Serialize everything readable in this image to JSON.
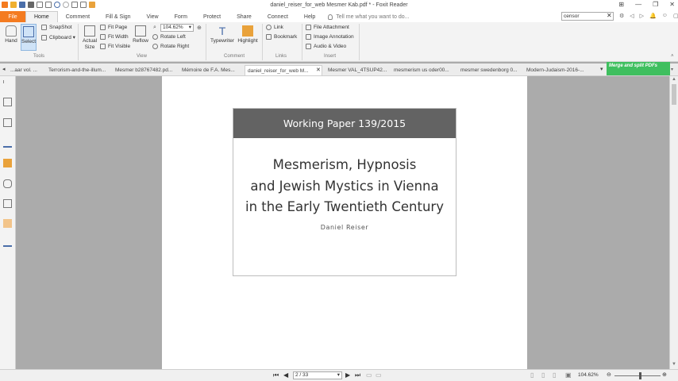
{
  "window": {
    "title": "daniel_reiser_for_web Mesmer Kab.pdf * - Foxit Reader",
    "controls": [
      "⊞",
      "—",
      "❐",
      "✕"
    ]
  },
  "menu": {
    "file": "File",
    "items": [
      "Home",
      "Comment",
      "Fill & Sign",
      "View",
      "Form",
      "Protect",
      "Share",
      "Connect",
      "Help"
    ],
    "tell_me": "Tell me what you want to do...",
    "search_value": "censor"
  },
  "ribbon": {
    "hand": "Hand",
    "select": "Select",
    "snapshot": "SnapShot",
    "clipboard": "Clipboard",
    "tools_group": "Tools",
    "actual_size": "Actual Size",
    "fit_page": "Fit Page",
    "fit_width": "Fit Width",
    "fit_visible": "Fit Visible",
    "reflow": "Reflow",
    "zoom": "104.62%",
    "rotate_left": "Rotate Left",
    "rotate_right": "Rotate Right",
    "view_group": "View",
    "typewriter": "Typewriter",
    "highlight": "Highlight",
    "comment_group": "Comment",
    "link": "Link",
    "bookmark": "Bookmark",
    "links_group": "Links",
    "file_attachment": "File Attachment",
    "image_annotation": "Image Annotation",
    "audio_video": "Audio & Video",
    "insert_group": "Insert"
  },
  "tabs": [
    "...aar vol. ...",
    "Terrorism-and-the-illum...",
    "Mesmer b28767482.pd...",
    "Mémoire de F.A. Mes...",
    "daniel_reiser_for_web M...",
    "Mesmer VAL_4TSUP42...",
    "mesmerism us oder00...",
    "mesmer swedenborg 0...",
    "Modern-Judaism-2016-..."
  ],
  "active_tab_index": 4,
  "merge_banner": "Merge and split PDFs",
  "document": {
    "series": "Working Paper 139/2015",
    "title_lines": [
      "Mesmerism, Hypnosis",
      "and Jewish Mystics in Vienna",
      "in the Early Twentieth Century"
    ],
    "author": "Daniel Reiser"
  },
  "status": {
    "page": "2 / 33",
    "zoom": "104.62%"
  }
}
